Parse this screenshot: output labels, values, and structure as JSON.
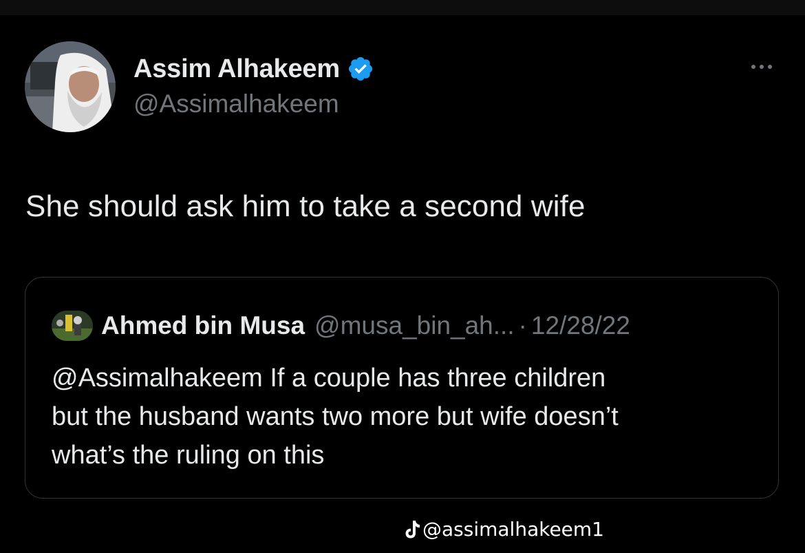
{
  "tweet": {
    "author": {
      "name": "Assim Alhakeem",
      "handle": "@Assimalhakeem",
      "verified": true
    },
    "text": "She should ask him to take a second wife",
    "more_icon": "more-horizontal-icon"
  },
  "quote": {
    "author": {
      "name": "Ahmed bin Musa",
      "handle": "@musa_bin_ah...",
      "separator": "·",
      "date": "12/28/22"
    },
    "text_lines": [
      "@Assimalhakeem If a couple has three children",
      "but the husband wants two more but wife doesn’t",
      "what’s the ruling on this"
    ]
  },
  "watermark": {
    "icon": "tiktok-icon",
    "text": "@assimalhakeem1"
  },
  "colors": {
    "background": "#000000",
    "text_primary": "#e7e9ea",
    "text_secondary": "#71767b",
    "verified_blue": "#1d9bf0",
    "card_border": "#2f3336"
  }
}
